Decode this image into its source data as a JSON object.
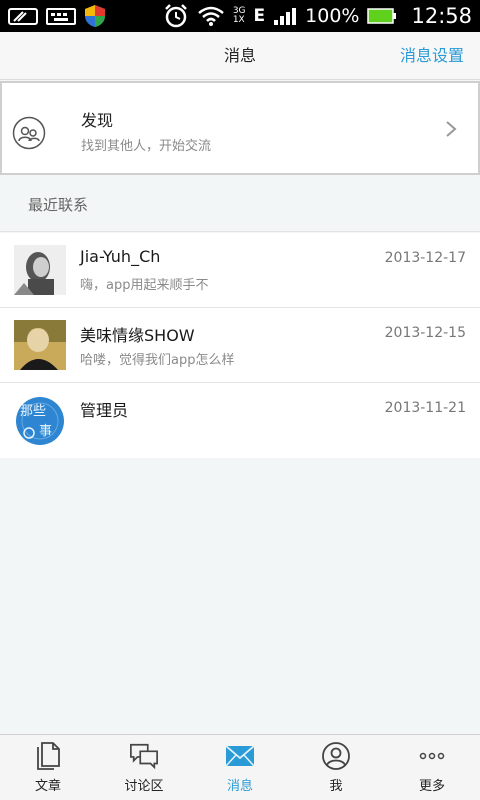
{
  "status_bar": {
    "network_top": "3G",
    "network_bottom": "1X",
    "network_type": "E",
    "battery_text": "100%",
    "time": "12:58",
    "icons": [
      "screenshot-icon",
      "keyboard-icon",
      "shield-icon",
      "alarm-icon",
      "wifi-icon",
      "signal-icon",
      "battery-icon"
    ]
  },
  "header": {
    "title": "消息",
    "action": "消息设置"
  },
  "discover": {
    "title": "发现",
    "subtitle": "找到其他人，开始交流"
  },
  "recent": {
    "label": "最近联系",
    "contacts": [
      {
        "name": "Jia-Yuh_Ch",
        "message": "嗨，app用起来顺手不",
        "date": "2013-12-17"
      },
      {
        "name": "美味情缘SHOW",
        "message": "哈喽，觉得我们app怎么样",
        "date": "2013-12-15"
      },
      {
        "name": "管理员",
        "message": "",
        "date": "2013-11-21",
        "avatar_text_1": "那些",
        "avatar_text_2": "事"
      }
    ]
  },
  "bottom_nav": {
    "items": [
      {
        "label": "文章",
        "icon": "document-icon",
        "active": false
      },
      {
        "label": "讨论区",
        "icon": "chat-bubbles-icon",
        "active": false
      },
      {
        "label": "消息",
        "icon": "mail-icon",
        "active": true
      },
      {
        "label": "我",
        "icon": "person-icon",
        "active": false
      },
      {
        "label": "更多",
        "icon": "more-icon",
        "active": false
      }
    ]
  },
  "colors": {
    "accent": "#2a9bd6",
    "battery": "#5fd11c",
    "shield_red": "#e23b2e",
    "shield_yellow": "#f5b70a",
    "shield_green": "#2fa84a",
    "shield_blue": "#2f73d6"
  }
}
